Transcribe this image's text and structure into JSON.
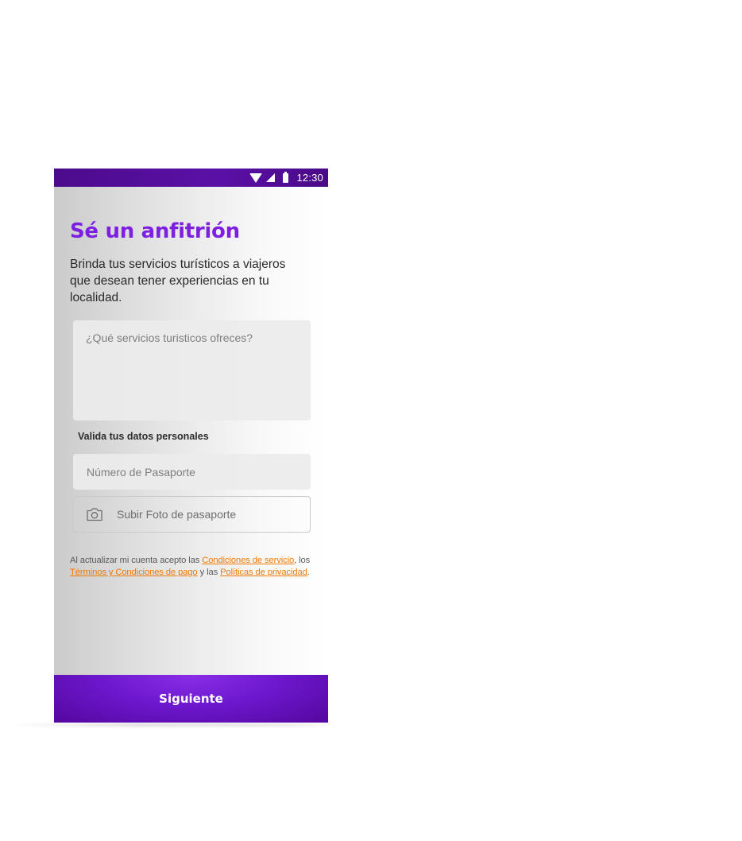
{
  "status_bar": {
    "time": "12:30",
    "icons": [
      "wifi-icon",
      "signal-icon",
      "battery-icon"
    ]
  },
  "header": {
    "title": "Sé un anfitrión",
    "description": "Brinda tus servicios turísticos a viajeros que desean tener experiencias en tu localidad."
  },
  "form": {
    "services_placeholder": "¿Qué servicios turisticos ofreces?",
    "services_value": "",
    "section_label": "Valida tus datos personales",
    "passport_placeholder": "Número de Pasaporte",
    "passport_value": "",
    "upload_label": "Subir Foto de pasaporte",
    "upload_icon": "camera-icon"
  },
  "terms": {
    "prefix": "Al actualizar mi cuenta acepto las ",
    "link_service": "Condiciones de servicio",
    "sep1": ", los ",
    "link_payment": "Términos y Condiciones de pago",
    "sep2": " y las ",
    "link_privacy": "Políticas de privacidad",
    "suffix": "."
  },
  "footer": {
    "next_label": "Siguiente"
  },
  "colors": {
    "accent": "#7d1fe0",
    "status_bar": "#4c0b8c",
    "link": "#f07800",
    "button": "#6d18cf"
  }
}
